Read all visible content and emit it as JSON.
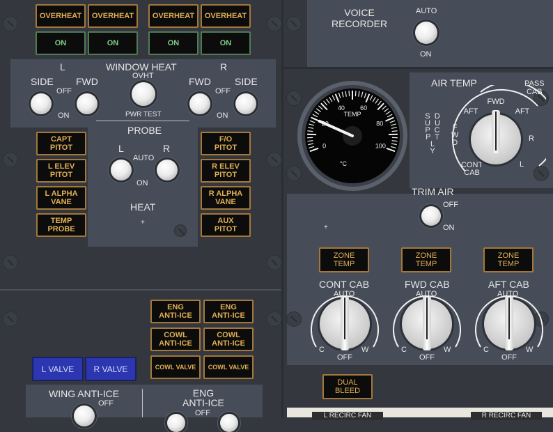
{
  "overheat_annunciators": [
    {
      "overheat": "OVERHEAT",
      "on": "ON"
    },
    {
      "overheat": "OVERHEAT",
      "on": "ON"
    },
    {
      "overheat": "OVERHEAT",
      "on": "ON"
    },
    {
      "overheat": "OVERHEAT",
      "on": "ON"
    }
  ],
  "window_heat": {
    "title": "WINDOW HEAT",
    "left_marker": "L",
    "right_marker": "R",
    "side": "SIDE",
    "fwd": "FWD",
    "off": "OFF",
    "on": "ON",
    "ovht": "OVHT",
    "pwr_test": "PWR TEST"
  },
  "probe_heat": {
    "title": "PROBE",
    "heat": "HEAT",
    "left": "L",
    "right": "R",
    "auto": "AUTO",
    "on": "ON",
    "left_lights": [
      "CAPT\nPITOT",
      "L ELEV\nPITOT",
      "L ALPHA\nVANE",
      "TEMP\nPROBE"
    ],
    "right_lights": [
      "F/O\nPITOT",
      "R ELEV\nPITOT",
      "R ALPHA\nVANE",
      "AUX\nPITOT"
    ]
  },
  "anti_ice": {
    "eng_lights": [
      "ENG\nANTI-ICE",
      "ENG\nANTI-ICE"
    ],
    "cowl_lights": [
      "COWL\nANTI-ICE",
      "COWL\nANTI-ICE"
    ],
    "cowl_valves": [
      "COWL VALVE",
      "COWL VALVE"
    ],
    "l_valve": "L VALVE",
    "r_valve": "R VALVE",
    "wing_title": "WING ANTI-ICE",
    "wing_off": "OFF",
    "eng_title": "ENG\nANTI-ICE",
    "eng_off": "OFF"
  },
  "voice_recorder": {
    "title": "VOICE\nRECORDER",
    "auto": "AUTO",
    "on": "ON"
  },
  "temp_gauge": {
    "label": "TEMP",
    "unit": "°C",
    "scale": [
      0,
      20,
      40,
      60,
      80,
      100
    ],
    "pointer_value": 20
  },
  "air_temp": {
    "title": "AIR TEMP",
    "pass_cab": "PASS\nCAB",
    "supply_duct": "SUPPLY\nDUCT",
    "positions": [
      "AFT",
      "FWD",
      "AFT",
      "R",
      "L",
      "CONT\nCAB"
    ],
    "fwd_side": "F\nW\nD"
  },
  "trim_air": {
    "title": "TRIM AIR",
    "off": "OFF",
    "on": "ON"
  },
  "zones": [
    {
      "light": "ZONE\nTEMP",
      "name": "CONT CAB",
      "auto": "AUTO",
      "cold": "C",
      "warm": "W",
      "off": "OFF"
    },
    {
      "light": "ZONE\nTEMP",
      "name": "FWD CAB",
      "auto": "AUTO",
      "cold": "C",
      "warm": "W",
      "off": "OFF"
    },
    {
      "light": "ZONE\nTEMP",
      "name": "AFT CAB",
      "auto": "AUTO",
      "cold": "C",
      "warm": "W",
      "off": "OFF"
    }
  ],
  "dual_bleed": "DUAL\nBLEED",
  "recirc": [
    "L RECIRC FAN",
    "R RECIRC FAN"
  ]
}
